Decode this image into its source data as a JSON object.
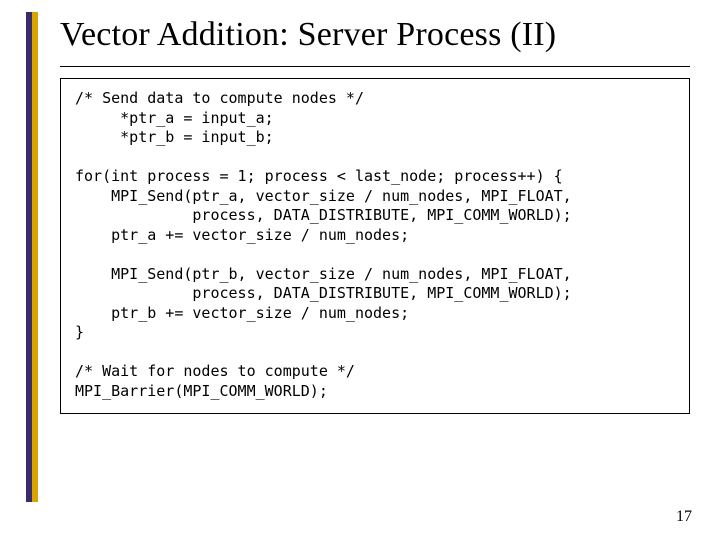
{
  "title": "Vector Addition: Server Process (II)",
  "page_number": "17",
  "code": "/* Send data to compute nodes */\n     *ptr_a = input_a;\n     *ptr_b = input_b;\n\nfor(int process = 1; process < last_node; process++) {\n    MPI_Send(ptr_a, vector_size / num_nodes, MPI_FLOAT,\n             process, DATA_DISTRIBUTE, MPI_COMM_WORLD);\n    ptr_a += vector_size / num_nodes;\n\n    MPI_Send(ptr_b, vector_size / num_nodes, MPI_FLOAT,\n             process, DATA_DISTRIBUTE, MPI_COMM_WORLD);\n    ptr_b += vector_size / num_nodes;\n}\n\n/* Wait for nodes to compute */\nMPI_Barrier(MPI_COMM_WORLD);"
}
